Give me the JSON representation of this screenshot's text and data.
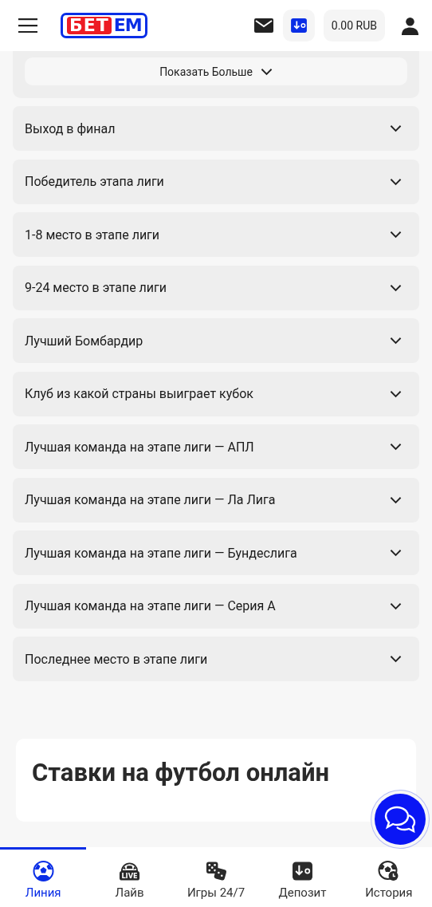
{
  "header": {
    "logo": {
      "part_1": "БЕТ",
      "part_2": "ЕМ"
    },
    "balance": "0.00 RUB"
  },
  "show_more": {
    "label": "Показать Больше"
  },
  "markets": [
    {
      "label": "Выход в финал",
      "expanded": false
    },
    {
      "label": "Победитель этапа лиги",
      "expanded": false
    },
    {
      "label": "1-8 место в этапе лиги",
      "expanded": false
    },
    {
      "label": "9-24 место в этапе лиги",
      "expanded": false
    },
    {
      "label": "Лучший Бомбардир",
      "expanded": false
    },
    {
      "label": "Клуб из какой страны выиграет кубок",
      "expanded": false
    },
    {
      "label": "Лучшая команда на этапе лиги — АПЛ",
      "expanded": false
    },
    {
      "label": "Лучшая команда на этапе лиги — Ла Лига",
      "expanded": false
    },
    {
      "label": "Лучшая команда на этапе лиги — Бундеслига",
      "expanded": false
    },
    {
      "label": "Лучшая команда на этапе лиги — Серия А",
      "expanded": false
    },
    {
      "label": "Последнее место в этапе лиги",
      "expanded": false
    }
  ],
  "seo": {
    "title": "Ставки на футбол онлайн"
  },
  "bottom_nav": [
    {
      "kind": "ball",
      "label": "Линия",
      "selected": true
    },
    {
      "kind": "live",
      "label": "Лайв",
      "badge": "LIVE",
      "selected": false
    },
    {
      "kind": "dice",
      "label": "Игры 24/7",
      "selected": false
    },
    {
      "kind": "deposit",
      "label": "Депозит",
      "selected": false
    },
    {
      "kind": "history",
      "label": "История",
      "selected": false
    }
  ]
}
